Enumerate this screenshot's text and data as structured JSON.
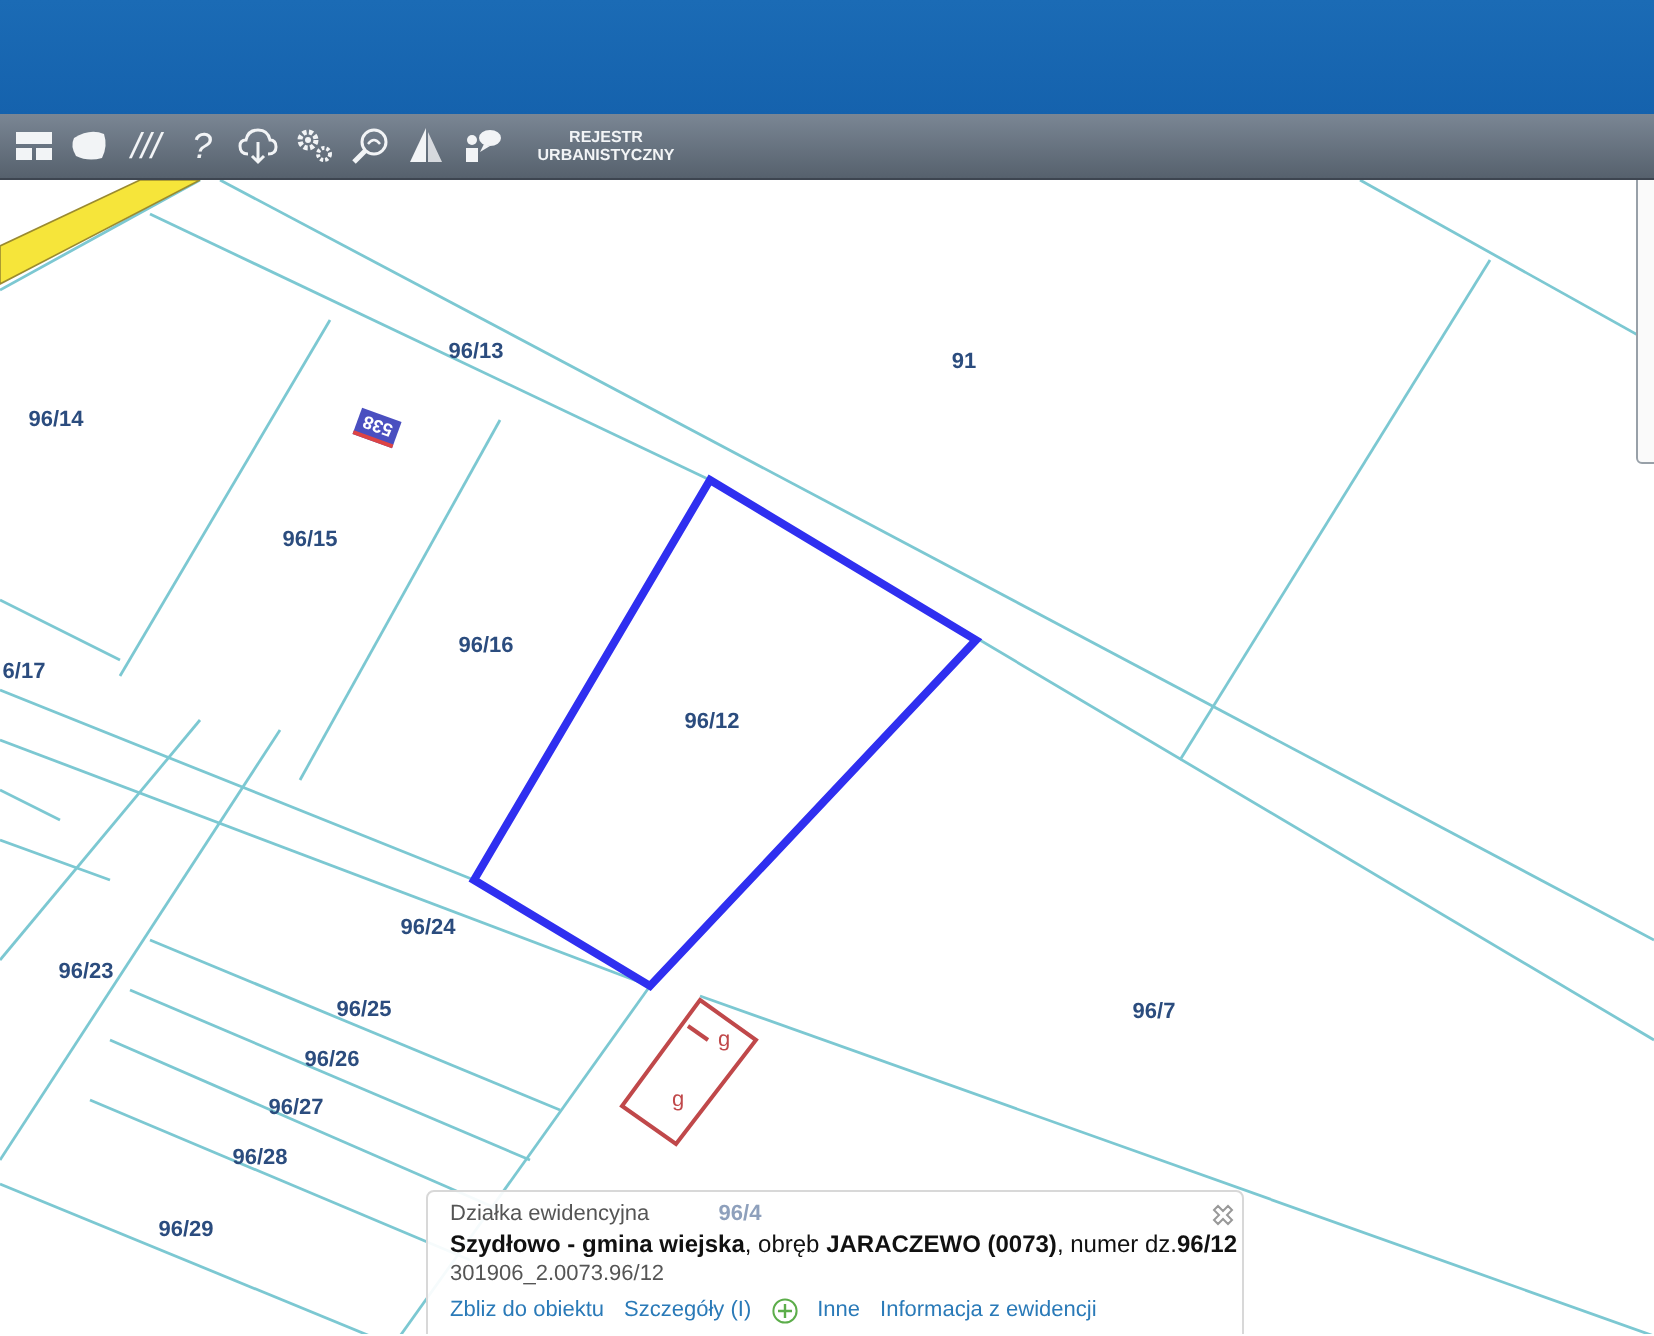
{
  "toolbar": {
    "glyph_buttons": [
      "///",
      "?"
    ],
    "register_button": "REJESTR URBANISTYCZNY"
  },
  "map": {
    "parcels": [
      {
        "label": "96/13"
      },
      {
        "label": "91"
      },
      {
        "label": "96/14"
      },
      {
        "label": "96/15"
      },
      {
        "label": "96/16"
      },
      {
        "label": "6/17"
      },
      {
        "label": "96/24"
      },
      {
        "label": "96/23"
      },
      {
        "label": "96/25"
      },
      {
        "label": "96/26"
      },
      {
        "label": "96/27"
      },
      {
        "label": "96/28"
      },
      {
        "label": "96/29"
      },
      {
        "label": "96/7"
      },
      {
        "label": "96/4"
      }
    ],
    "selected_parcel": {
      "label": "96/12"
    },
    "building_number": "538",
    "building_labels": [
      "g",
      "g"
    ]
  },
  "popup": {
    "type_label": "Działka ewidencyjna",
    "description": "**Szydłowo - gmina wiejska**, obręb **JARACZEWO (0073)**, numer dz.**96/12**",
    "identifier": "301906_2.0073.96/12",
    "actions": [
      "Zbliz do obiektu",
      "Szczegóły (I)",
      "Inne",
      "Informacja z ewidencji"
    ]
  }
}
